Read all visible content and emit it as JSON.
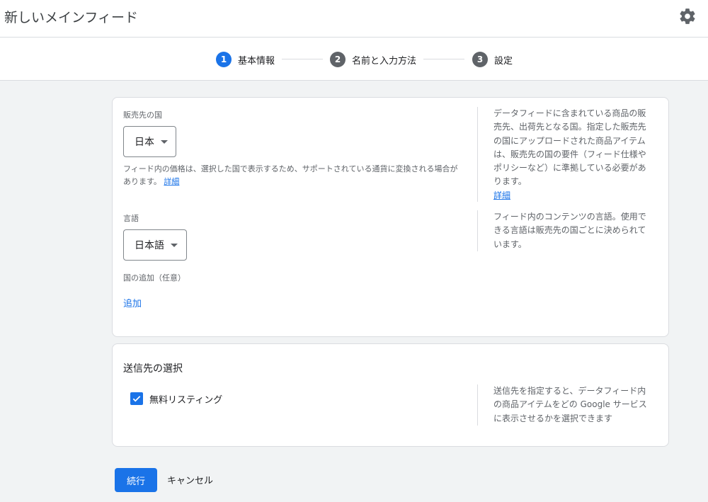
{
  "header": {
    "title": "新しいメインフィード",
    "settings_icon": "gear-icon"
  },
  "stepper": {
    "steps": [
      {
        "number": "1",
        "label": "基本情報",
        "state": "active",
        "color": "#1a73e8"
      },
      {
        "number": "2",
        "label": "名前と入力方法",
        "state": "inactive",
        "color": "#5f6368"
      },
      {
        "number": "3",
        "label": "設定",
        "state": "inactive",
        "color": "#5f6368"
      }
    ]
  },
  "basic_card": {
    "country": {
      "label": "販売先の国",
      "value": "日本",
      "helper": "フィード内の価格は、選択した国で表示するため、サポートされている通貨に変換される場合があります。",
      "helper_link": "詳細",
      "side_help": "データフィードに含まれている商品の販売先、出荷先となる国。指定した販売先の国にアップロードされた商品アイテムは、販売先の国の要件（フィード仕様やポリシーなど）に準拠している必要があります。",
      "side_help_link": "詳細"
    },
    "language": {
      "label": "言語",
      "value": "日本語",
      "side_help": "フィード内のコンテンツの言語。使用できる言語は販売先の国ごとに決められています。"
    },
    "add_country": {
      "label": "国の追加（任意）",
      "link": "追加"
    }
  },
  "destinations_card": {
    "title": "送信先の選択",
    "option": {
      "label": "無料リスティング",
      "checked": true
    },
    "side_help": "送信先を指定すると、データフィード内の商品アイテムをどの Google サービスに表示させるかを選択できます"
  },
  "footer": {
    "continue_label": "続行",
    "cancel_label": "キャンセル"
  },
  "colors": {
    "accent": "#1a73e8",
    "inactive_step": "#5f6368",
    "background": "#f1f3f4"
  }
}
